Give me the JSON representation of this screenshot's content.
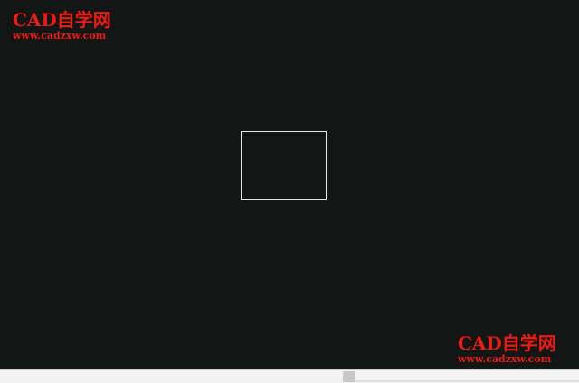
{
  "watermark": {
    "title": "CAD自学网",
    "url": "www.cadzxw.com",
    "color": "#ee1a14"
  },
  "canvas": {
    "background": "#121715",
    "shape": "rectangle"
  }
}
